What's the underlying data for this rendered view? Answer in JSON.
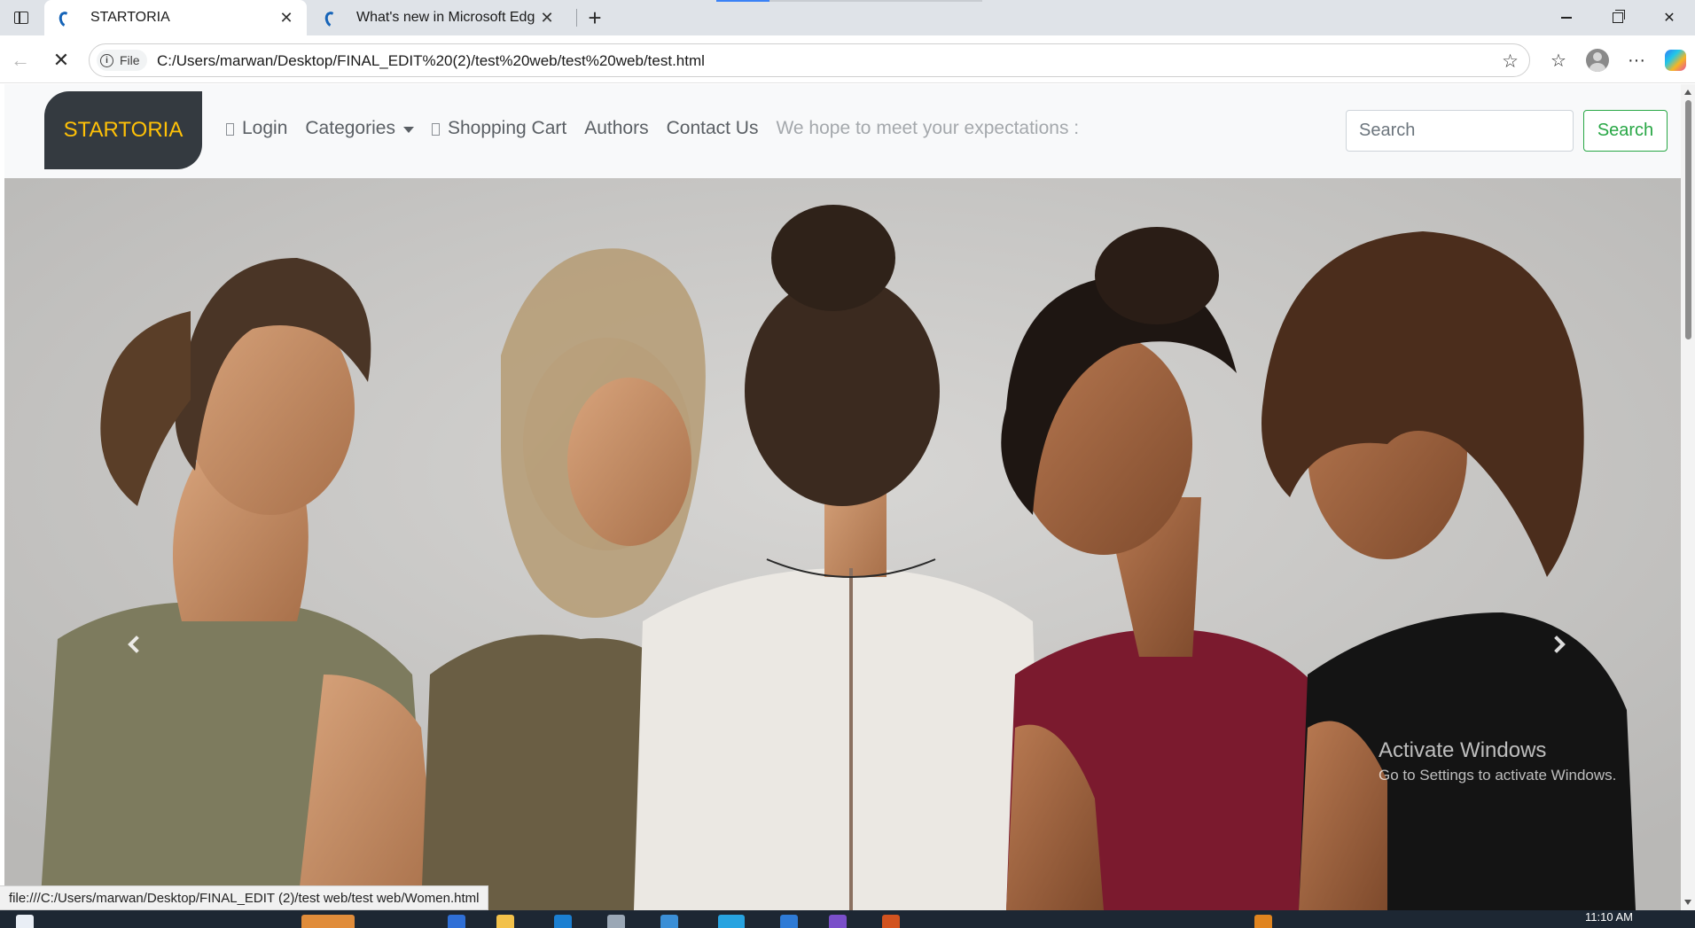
{
  "browser": {
    "tabs": [
      {
        "title": "STARTORIA",
        "active": true
      },
      {
        "title": "What's new in Microsoft Edge",
        "active": false
      }
    ],
    "address": {
      "badge": "File",
      "url": "C:/Users/marwan/Desktop/FINAL_EDIT%20(2)/test%20web/test%20web/test.html"
    },
    "status_url": "file:///C:/Users/marwan/Desktop/FINAL_EDIT (2)/test web/test web/Women.html"
  },
  "site": {
    "brand": "STARTORIA",
    "nav": {
      "login": "Login",
      "categories": "Categories",
      "cart": "Shopping Cart",
      "authors": "Authors",
      "contact": "Contact Us"
    },
    "tagline": "We hope to meet your expectations :",
    "search": {
      "placeholder": "Search",
      "button": "Search"
    }
  },
  "watermark": {
    "title": "Activate Windows",
    "subtitle": "Go to Settings to activate Windows."
  },
  "taskbar": {
    "clock": "11:10 AM"
  },
  "colors": {
    "brand_bg": "#343a40",
    "brand_text": "#ffc107",
    "search_button": "#28a745",
    "navbar_bg": "#f8f9fa"
  }
}
